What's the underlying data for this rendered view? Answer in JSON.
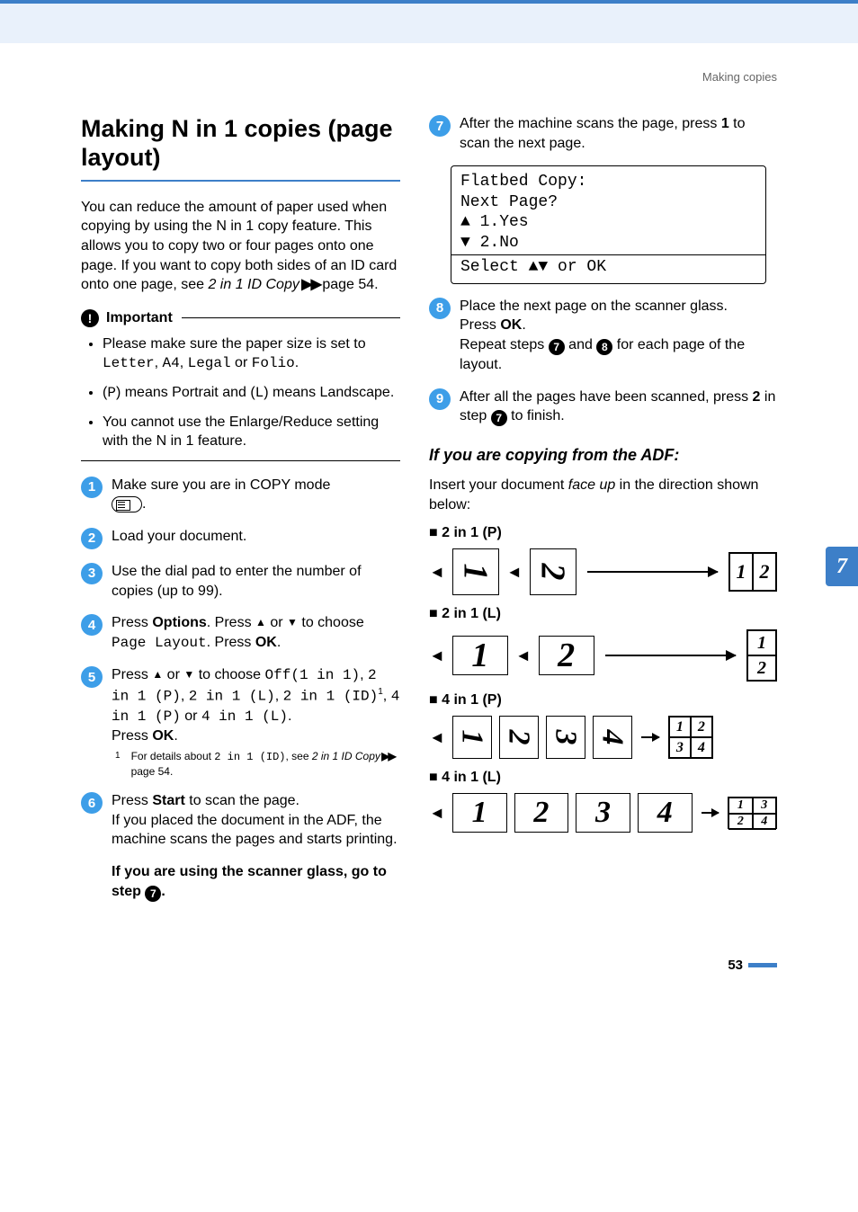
{
  "running_head": "Making copies",
  "chapter_tab": "7",
  "page_number": "53",
  "title": "Making N in 1 copies (page layout)",
  "intro": {
    "text1": "You can reduce the amount of paper used when copying by using the N in 1 copy feature. This allows you to copy two or four pages onto one page. If you want to copy both sides of an ID card onto one page, see ",
    "link": "2 in 1 ID Copy",
    "arrows": " ▶▶ ",
    "pageref": "page 54."
  },
  "important_label": "Important",
  "important": {
    "i1a": "Please make sure the paper size is set to ",
    "i1b": "Letter",
    "i1c": ", ",
    "i1d": "A4",
    "i1e": ", ",
    "i1f": "Legal",
    "i1g": " or ",
    "i1h": "Folio",
    "i1i": ".",
    "i2a": "(",
    "i2b": "P",
    "i2c": ") means Portrait and (",
    "i2d": "L",
    "i2e": ") means Landscape.",
    "i3": "You cannot use the Enlarge/Reduce setting with the N in 1 feature."
  },
  "steps_left": {
    "s1": "Make sure you are in COPY mode ",
    "s1_end": ".",
    "s2": "Load your document.",
    "s3": "Use the dial pad to enter the number of copies (up to 99).",
    "s4a": "Press ",
    "s4b": "Options",
    "s4c": ". Press ",
    "s4d": " or ",
    "s4e": " to choose ",
    "s4f": "Page Layout",
    "s4g": ". Press ",
    "s4h": "OK",
    "s4i": ".",
    "s5a": "Press ",
    "s5b": " or ",
    "s5c": " to choose ",
    "s5d": "Off(1 in 1)",
    "s5e": ", ",
    "s5f": "2 in 1 (P)",
    "s5g": ", ",
    "s5h": "2 in 1 (L)",
    "s5i": ", ",
    "s5j": "2 in 1 (ID)",
    "s5k": ", ",
    "s5l": "4 in 1 (P)",
    "s5m": " or ",
    "s5n": "4 in 1 (L)",
    "s5o": ".",
    "s5p": "Press ",
    "s5q": "OK",
    "s5r": ".",
    "fn_num": "1",
    "fn_a": "For details about ",
    "fn_b": "2 in 1 (ID)",
    "fn_c": ", see ",
    "fn_d": "2 in 1 ID Copy",
    "fn_arrows": " ▶▶ ",
    "fn_e": "page 54.",
    "s6a": "Press ",
    "s6b": "Start",
    "s6c": " to scan the page.",
    "s6d": "If you placed the document in the ADF, the machine scans the pages and starts printing.",
    "s6e": "If you are using the scanner glass, go to step ",
    "s6f": "."
  },
  "steps_right": {
    "s7a": "After the machine scans the page, press ",
    "s7b": "1",
    "s7c": " to scan the next page.",
    "lcd1": "Flatbed Copy:",
    "lcd2": " Next Page?",
    "lcd3": "▲ 1.Yes",
    "lcd4": "▼ 2.No",
    "lcd5": "Select ▲▼ or OK",
    "s8a": "Place the next page on the scanner glass.",
    "s8b": "Press ",
    "s8c": "OK",
    "s8d": ".",
    "s8e": "Repeat steps ",
    "s8f": " and ",
    "s8g": " for each page of the layout.",
    "s9a": "After all the pages have been scanned, press ",
    "s9b": "2",
    "s9c": " in step ",
    "s9d": " to finish."
  },
  "adf_heading": "If you are copying from the ADF:",
  "adf_intro_a": "Insert your document ",
  "adf_intro_b": "face up",
  "adf_intro_c": " in the direction shown below:",
  "layouts": {
    "l1": "2 in 1 (P)",
    "l2": "2 in 1 (L)",
    "l3": "4 in 1 (P)",
    "l4": "4 in 1 (L)"
  },
  "nums": {
    "n1": "1",
    "n2": "2",
    "n3": "3",
    "n4": "4",
    "n7": "7",
    "n8": "8",
    "n9": "9"
  },
  "step_nums": {
    "b1": "1",
    "b2": "2",
    "b3": "3",
    "b4": "4",
    "b5": "5",
    "b6": "6",
    "b7": "7",
    "b8": "8",
    "b9": "9"
  },
  "glyph": {
    "up": "▲",
    "down": "▼",
    "left": "◄"
  }
}
